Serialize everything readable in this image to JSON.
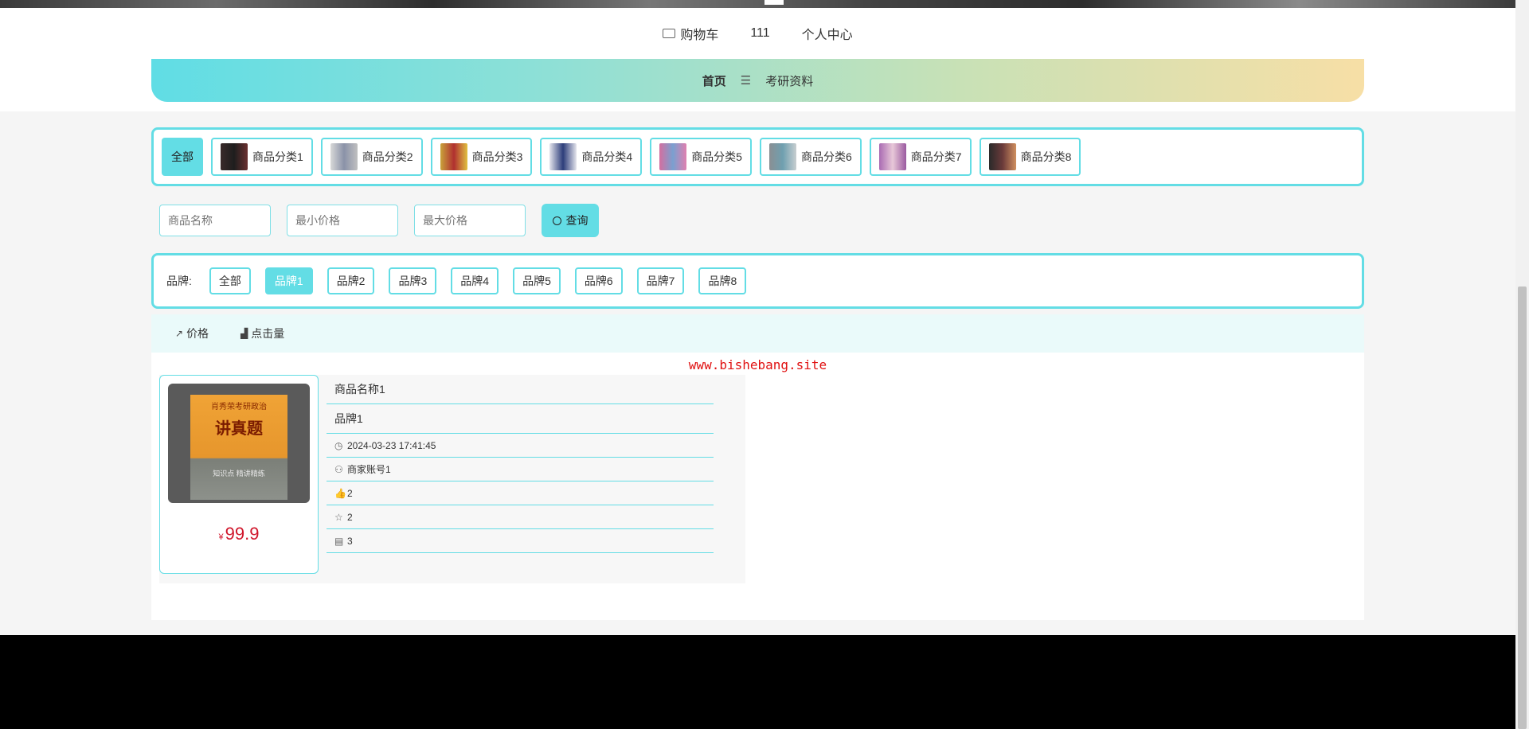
{
  "top_nav": {
    "cart_label": "购物车",
    "username": "111",
    "profile_label": "个人中心"
  },
  "main_nav": {
    "home": "首页",
    "separator": "☰",
    "exam_materials": "考研资料"
  },
  "categories": [
    {
      "label": "全部"
    },
    {
      "label": "商品分类1",
      "thumb_color": "#3a2a2a"
    },
    {
      "label": "商品分类2",
      "thumb_color": "#8a92a8"
    },
    {
      "label": "商品分类3",
      "thumb_color": "#c9a23a"
    },
    {
      "label": "商品分类4",
      "thumb_color": "#2c3d7a"
    },
    {
      "label": "商品分类5",
      "thumb_color": "#d46fa0"
    },
    {
      "label": "商品分类6",
      "thumb_color": "#6fa0b0"
    },
    {
      "label": "商品分类7",
      "thumb_color": "#a96ab3"
    },
    {
      "label": "商品分类8",
      "thumb_color": "#6b3a3a"
    }
  ],
  "search": {
    "name_placeholder": "商品名称",
    "min_price_placeholder": "最小价格",
    "max_price_placeholder": "最大价格",
    "query_label": "查询"
  },
  "brands": {
    "label": "品牌:",
    "items": [
      "全部",
      "品牌1",
      "品牌2",
      "品牌3",
      "品牌4",
      "品牌5",
      "品牌6",
      "品牌7",
      "品牌8"
    ],
    "active": "品牌1"
  },
  "sort": {
    "price_label": "价格",
    "clicks_label": "点击量"
  },
  "watermark": "www.bishebang.site",
  "product": {
    "image_title_top": "肖秀荣考研政治",
    "image_title_main": "讲真题",
    "image_title_bottom": "知识点 精讲精练",
    "currency": "¥",
    "price": "99.9",
    "name": "商品名称1",
    "brand": "品牌1",
    "date": "2024-03-23 17:41:45",
    "merchant": "商家账号1",
    "likes": "2",
    "favorites": "2",
    "comments": "3"
  },
  "colors": {
    "accent": "#63dde5",
    "price": "#d0152a",
    "watermark": "#e01010"
  }
}
